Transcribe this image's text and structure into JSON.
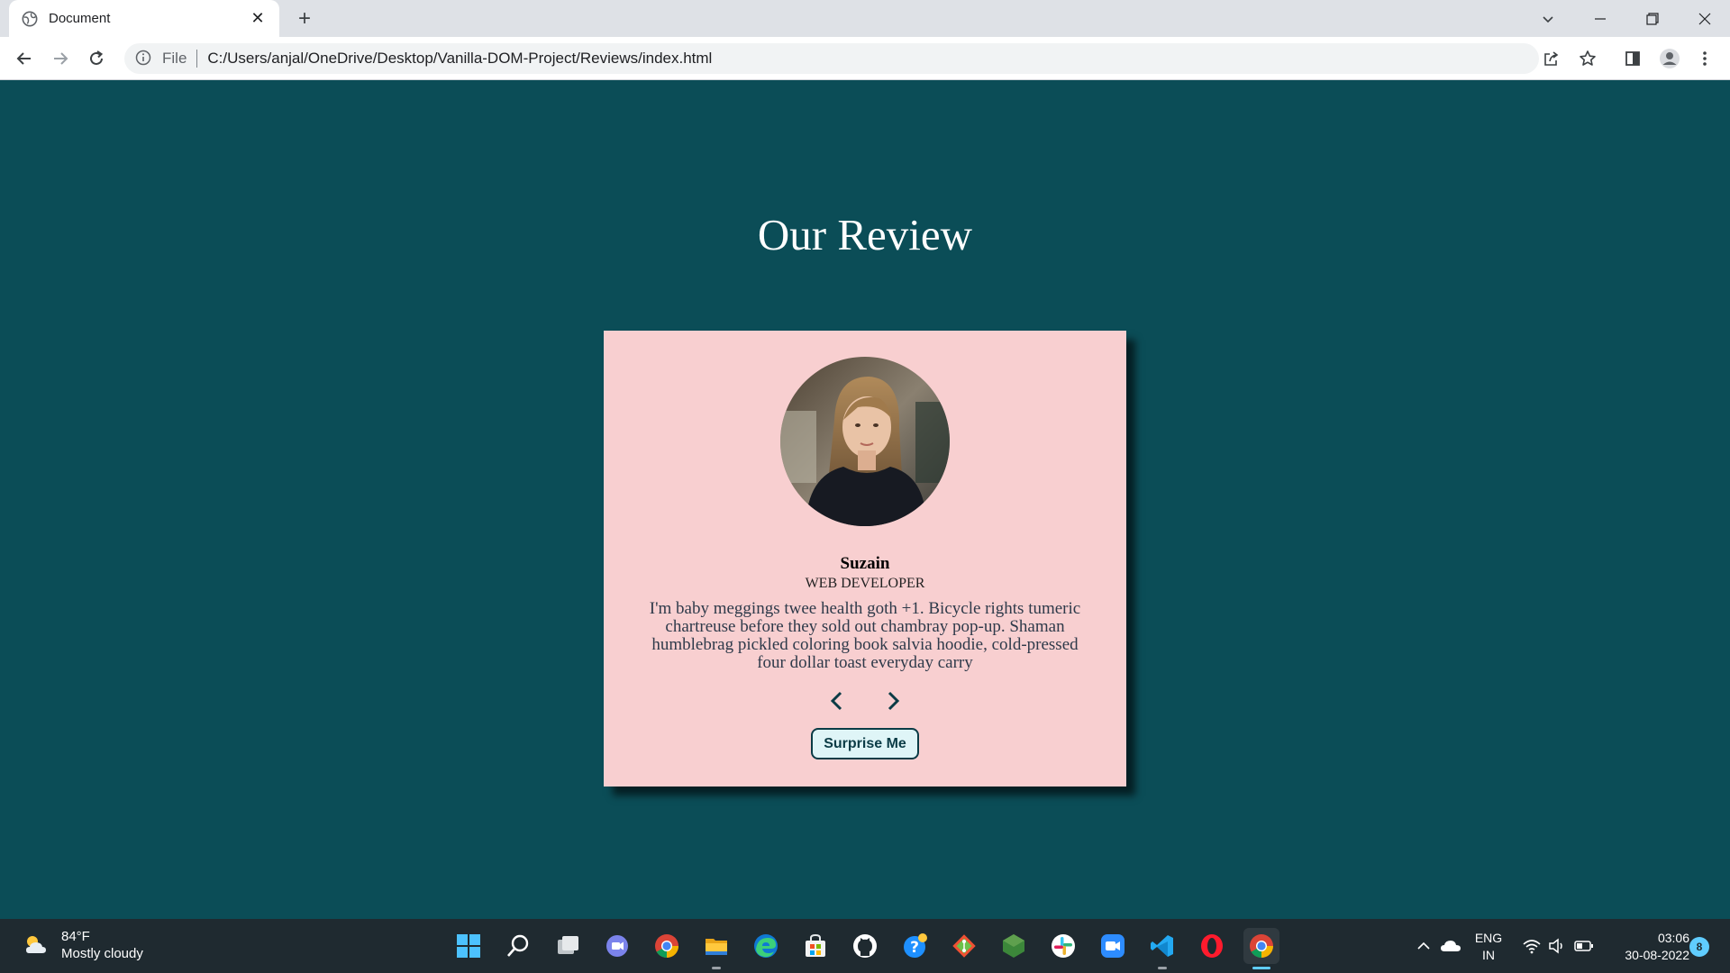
{
  "browser": {
    "tab_title": "Document",
    "address_scheme": "File",
    "address_url": "C:/Users/anjal/OneDrive/Desktop/Vanilla-DOM-Project/Reviews/index.html"
  },
  "page": {
    "heading": "Our Review",
    "review": {
      "name": "Suzain",
      "job": "WEB DEVELOPER",
      "text": "I'm baby meggings twee health goth +1. Bicycle rights tumeric chartreuse before they sold out chambray pop-up. Shaman humblebrag pickled coloring book salvia hoodie, cold-pressed four dollar toast everyday carry",
      "surprise_label": "Surprise Me"
    }
  },
  "taskbar": {
    "weather_temp": "84°F",
    "weather_desc": "Mostly cloudy",
    "lang_primary": "ENG",
    "lang_region": "IN",
    "time": "03:06",
    "date": "30-08-2022",
    "notification_count": "8",
    "apps": [
      "start-icon",
      "search-icon",
      "task-view-icon",
      "teams-chat-icon",
      "chrome-icon",
      "file-explorer-icon",
      "edge-icon",
      "store-icon",
      "github-icon",
      "help-icon",
      "git-icon",
      "nodejs-icon",
      "slack-icon",
      "zoom-icon",
      "vscode-icon",
      "opera-icon",
      "chrome-active-icon"
    ]
  },
  "colors": {
    "page_bg": "#0b4d57",
    "card_bg": "#f8cfd0",
    "taskbar_bg": "#1f2a30",
    "accent": "#60cdff"
  }
}
